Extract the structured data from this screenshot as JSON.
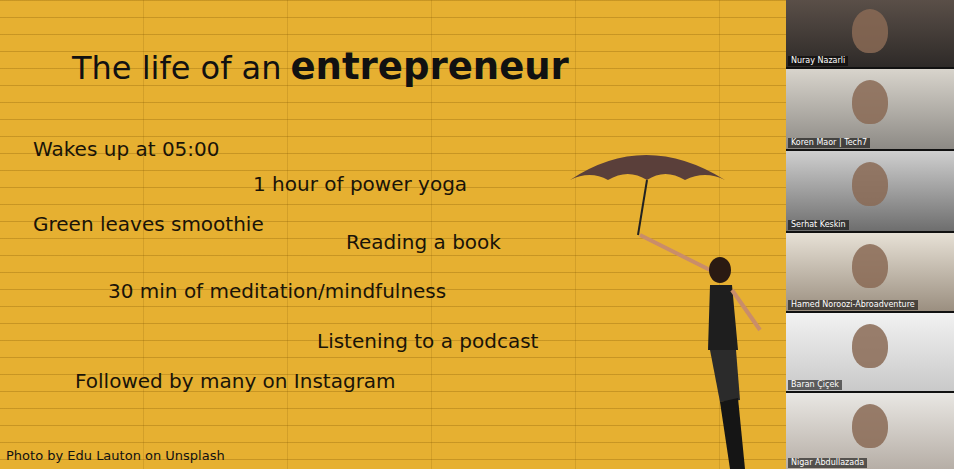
{
  "slide": {
    "title": {
      "prefix": "The life of an",
      "emphasis": "entrepreneur"
    },
    "items": [
      "Wakes up at 05:00",
      "1 hour of power yoga",
      "Green leaves smoothie",
      "Reading a book",
      "30 min of meditation/mindfulness",
      "Listening to a podcast",
      "Followed by many on Instagram"
    ],
    "credit": "Photo by Edu Lauton on Unsplash"
  },
  "participants": [
    {
      "name": "Nuray Nazarli"
    },
    {
      "name": "Koren Maor | Tech7"
    },
    {
      "name": "Serhat Keskin"
    },
    {
      "name": "Hamed Noroozi-Abroadventure"
    },
    {
      "name": "Baran Çiçek"
    },
    {
      "name": "Nigar Abdullazada"
    }
  ]
}
